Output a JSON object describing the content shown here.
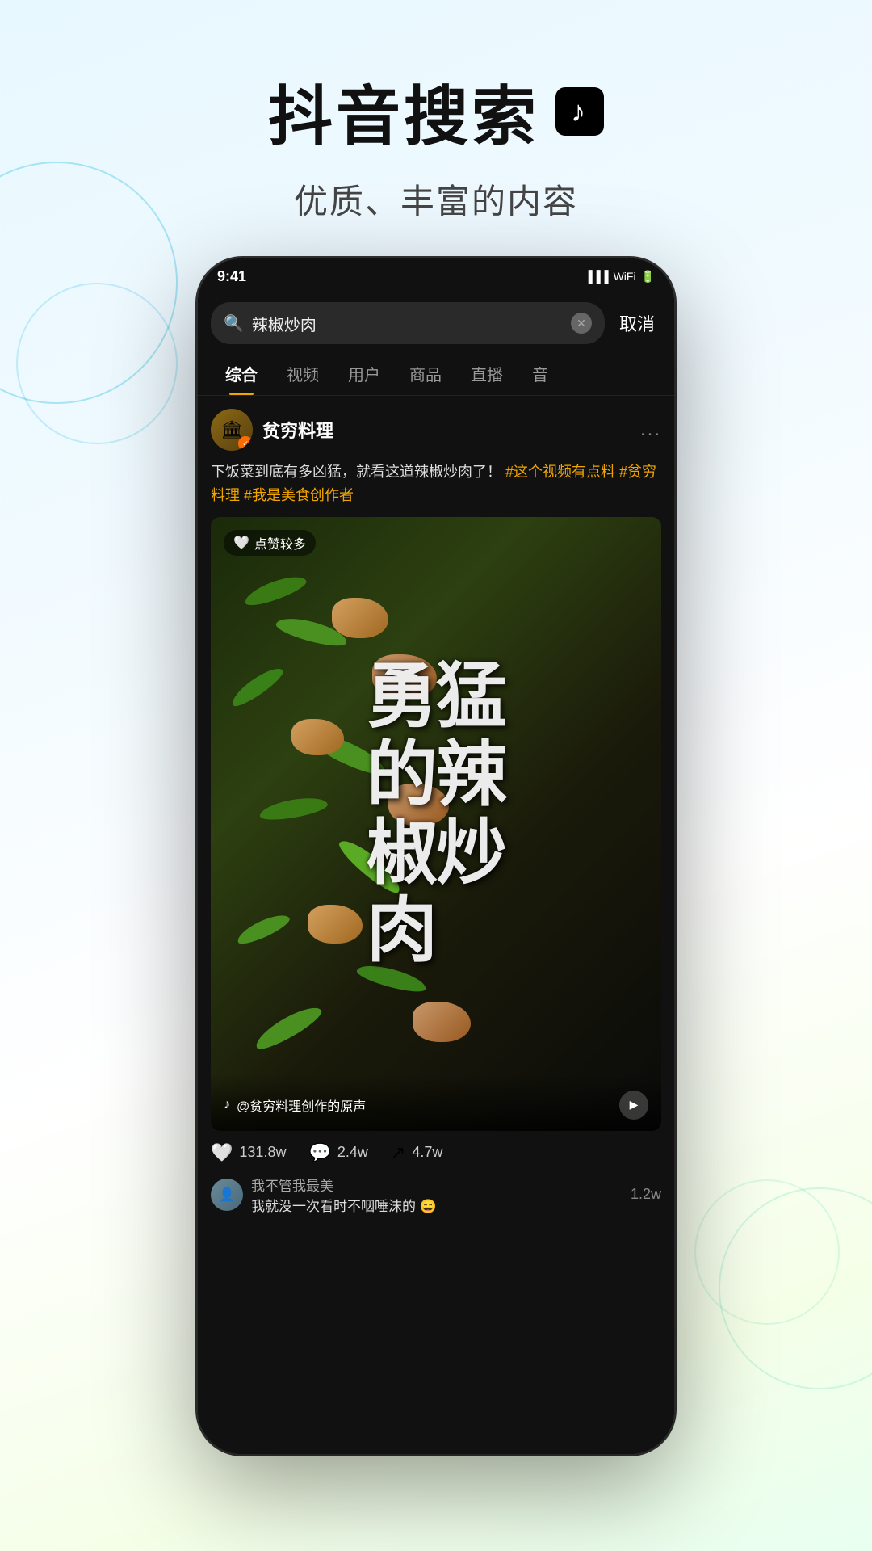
{
  "header": {
    "main_title": "抖音搜索",
    "subtitle": "优质、丰富的内容",
    "tiktok_icon": "♪"
  },
  "phone": {
    "status_bar": {
      "time": "9:41",
      "signal": "▐▐▐",
      "wifi": "▲",
      "battery": "▓"
    },
    "search_bar": {
      "query": "辣椒炒肉",
      "cancel_label": "取消"
    },
    "tabs": [
      {
        "label": "综合",
        "active": true
      },
      {
        "label": "视频",
        "active": false
      },
      {
        "label": "用户",
        "active": false
      },
      {
        "label": "商品",
        "active": false
      },
      {
        "label": "直播",
        "active": false
      },
      {
        "label": "音",
        "active": false
      }
    ],
    "post": {
      "username": "贫穷料理",
      "verified": true,
      "more_icon": "...",
      "description": "下饭菜到底有多凶猛，就看这道辣椒炒肉了！",
      "hashtags": [
        "#这个视频有点料",
        "#贫穷料理",
        "#我是美食创作者"
      ],
      "likes_badge": "点赞较多",
      "video": {
        "calligraphy_text": "勇\n猛\n的\n辣\n椒\n炒\n肉",
        "audio_info": "@贫穷料理创作的原声",
        "tiktok_logo": "♪"
      },
      "interactions": {
        "likes": "131.8w",
        "comments": "2.4w",
        "shares": "4.7w"
      },
      "comment_preview": {
        "username": "我不管我最美",
        "text": "我就没一次看时不咽唾沫的 😄",
        "count": "1.2w"
      }
    }
  },
  "colors": {
    "accent": "#f0a500",
    "bg_gradient_start": "#e8f8ff",
    "phone_bg": "#111111",
    "hashtag_color": "#f0a500"
  }
}
